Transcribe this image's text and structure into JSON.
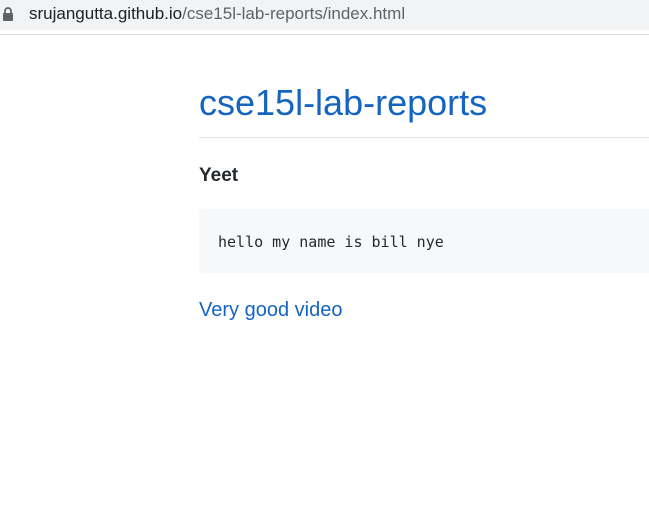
{
  "browser": {
    "url_host": "srujangutta.github.io",
    "url_path": "/cse15l-lab-reports/index.html",
    "lock_icon": "lock-icon"
  },
  "page": {
    "title": "cse15l-lab-reports",
    "heading": "Yeet",
    "code": "hello my name is bill nye",
    "link_text": "Very good video"
  },
  "colors": {
    "link": "#1565c0",
    "code_background": "#f6f8fa",
    "text": "#24292e"
  }
}
